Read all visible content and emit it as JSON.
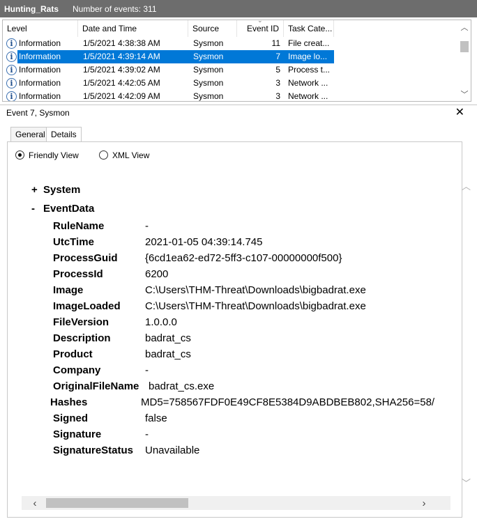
{
  "titlebar": {
    "log_name": "Hunting_Rats",
    "event_count": "Number of events: 311"
  },
  "events_table": {
    "columns": [
      "Level",
      "Date and Time",
      "Source",
      "Event ID",
      "Task Cate..."
    ],
    "rows": [
      {
        "level": "Information",
        "datetime": "1/5/2021 4:38:38 AM",
        "source": "Sysmon",
        "event_id": "11",
        "task": "File creat..."
      },
      {
        "level": "Information",
        "datetime": "1/5/2021 4:39:14 AM",
        "source": "Sysmon",
        "event_id": "7",
        "task": "Image lo...",
        "selected": true
      },
      {
        "level": "Information",
        "datetime": "1/5/2021 4:39:02 AM",
        "source": "Sysmon",
        "event_id": "5",
        "task": "Process t..."
      },
      {
        "level": "Information",
        "datetime": "1/5/2021 4:42:05 AM",
        "source": "Sysmon",
        "event_id": "3",
        "task": "Network ..."
      },
      {
        "level": "Information",
        "datetime": "1/5/2021 4:42:09 AM",
        "source": "Sysmon",
        "event_id": "3",
        "task": "Network ..."
      }
    ],
    "info_icon_glyph": "i"
  },
  "detail": {
    "title": "Event 7, Sysmon",
    "close_glyph": "✕",
    "tabs": [
      "General",
      "Details"
    ],
    "active_tab": "Details",
    "views": {
      "friendly": "Friendly View",
      "xml": "XML View",
      "selected": "friendly"
    },
    "system_node": {
      "toggle": "+",
      "label": "System"
    },
    "eventdata_node": {
      "toggle": "-",
      "label": "EventData"
    },
    "fields": [
      {
        "name": "RuleName",
        "value": "-"
      },
      {
        "name": "UtcTime",
        "value": "2021-01-05 04:39:14.745"
      },
      {
        "name": "ProcessGuid",
        "value": "{6cd1ea62-ed72-5ff3-c107-00000000f500}"
      },
      {
        "name": "ProcessId",
        "value": "6200"
      },
      {
        "name": "Image",
        "value": "C:\\Users\\THM-Threat\\Downloads\\bigbadrat.exe"
      },
      {
        "name": "ImageLoaded",
        "value": "C:\\Users\\THM-Threat\\Downloads\\bigbadrat.exe"
      },
      {
        "name": "FileVersion",
        "value": "1.0.0.0"
      },
      {
        "name": "Description",
        "value": "badrat_cs"
      },
      {
        "name": "Product",
        "value": "badrat_cs"
      },
      {
        "name": "Company",
        "value": "-"
      },
      {
        "name": "OriginalFileName",
        "value": "badrat_cs.exe"
      },
      {
        "name": "Hashes",
        "value": "MD5=758567FDF0E49CF8E5384D9ABDBEB802,SHA256=58/"
      },
      {
        "name": "Signed",
        "value": "false"
      },
      {
        "name": "Signature",
        "value": "-"
      },
      {
        "name": "SignatureStatus",
        "value": "Unavailable"
      }
    ]
  },
  "colors": {
    "titlebar_bg": "#6d6d6d",
    "selection": "#0078d7"
  }
}
